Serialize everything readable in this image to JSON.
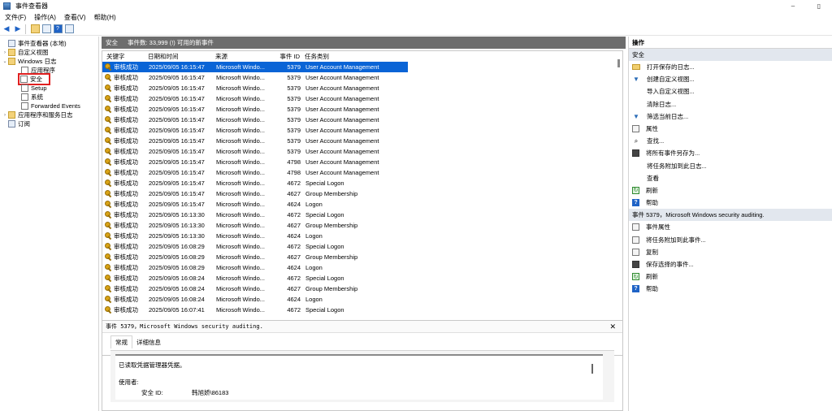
{
  "window": {
    "title": "事件查看器",
    "min": "–",
    "max": "▯"
  },
  "menu": [
    "文件(F)",
    "操作(A)",
    "查看(V)",
    "帮助(H)"
  ],
  "tree": [
    {
      "label": "事件查看器 (本地)",
      "indent": 0,
      "exp": "",
      "icon": "eventviewer-icon"
    },
    {
      "label": "自定义视图",
      "indent": 1,
      "exp": "›",
      "icon": "folder-icon"
    },
    {
      "label": "Windows 日志",
      "indent": 1,
      "exp": "⌄",
      "icon": "folder-icon"
    },
    {
      "label": "应用程序",
      "indent": 2,
      "exp": "",
      "icon": "log-icon"
    },
    {
      "label": "安全",
      "indent": 2,
      "exp": "",
      "icon": "log-icon",
      "selected": true
    },
    {
      "label": "Setup",
      "indent": 2,
      "exp": "",
      "icon": "log-icon"
    },
    {
      "label": "系统",
      "indent": 2,
      "exp": "",
      "icon": "log-icon"
    },
    {
      "label": "Forwarded Events",
      "indent": 2,
      "exp": "",
      "icon": "log-icon"
    },
    {
      "label": "应用程序和服务日志",
      "indent": 1,
      "exp": "›",
      "icon": "folder-icon"
    },
    {
      "label": "订阅",
      "indent": 1,
      "exp": "",
      "icon": "subscription-icon"
    }
  ],
  "log_header": {
    "name": "安全",
    "summary": "事件数: 33,999 (!) 可用的新事件"
  },
  "columns": {
    "keyword": "关键字",
    "datetime": "日期和时间",
    "source": "来源",
    "event_id": "事件 ID",
    "task": "任务类别"
  },
  "events": [
    {
      "kw": "审核成功",
      "dt": "2025/09/05 16:15:47",
      "src": "Microsoft Windo...",
      "id": "5379",
      "task": "User Account Management"
    },
    {
      "kw": "审核成功",
      "dt": "2025/09/05 16:15:47",
      "src": "Microsoft Windo...",
      "id": "5379",
      "task": "User Account Management"
    },
    {
      "kw": "审核成功",
      "dt": "2025/09/05 16:15:47",
      "src": "Microsoft Windo...",
      "id": "5379",
      "task": "User Account Management"
    },
    {
      "kw": "审核成功",
      "dt": "2025/09/05 16:15:47",
      "src": "Microsoft Windo...",
      "id": "5379",
      "task": "User Account Management"
    },
    {
      "kw": "审核成功",
      "dt": "2025/09/05 16:15:47",
      "src": "Microsoft Windo...",
      "id": "5379",
      "task": "User Account Management"
    },
    {
      "kw": "审核成功",
      "dt": "2025/09/05 16:15:47",
      "src": "Microsoft Windo...",
      "id": "5379",
      "task": "User Account Management"
    },
    {
      "kw": "审核成功",
      "dt": "2025/09/05 16:15:47",
      "src": "Microsoft Windo...",
      "id": "5379",
      "task": "User Account Management"
    },
    {
      "kw": "审核成功",
      "dt": "2025/09/05 16:15:47",
      "src": "Microsoft Windo...",
      "id": "5379",
      "task": "User Account Management"
    },
    {
      "kw": "审核成功",
      "dt": "2025/09/05 16:15:47",
      "src": "Microsoft Windo...",
      "id": "5379",
      "task": "User Account Management"
    },
    {
      "kw": "审核成功",
      "dt": "2025/09/05 16:15:47",
      "src": "Microsoft Windo...",
      "id": "4798",
      "task": "User Account Management"
    },
    {
      "kw": "审核成功",
      "dt": "2025/09/05 16:15:47",
      "src": "Microsoft Windo...",
      "id": "4798",
      "task": "User Account Management"
    },
    {
      "kw": "审核成功",
      "dt": "2025/09/05 16:15:47",
      "src": "Microsoft Windo...",
      "id": "4672",
      "task": "Special Logon"
    },
    {
      "kw": "审核成功",
      "dt": "2025/09/05 16:15:47",
      "src": "Microsoft Windo...",
      "id": "4627",
      "task": "Group Membership"
    },
    {
      "kw": "审核成功",
      "dt": "2025/09/05 16:15:47",
      "src": "Microsoft Windo...",
      "id": "4624",
      "task": "Logon"
    },
    {
      "kw": "审核成功",
      "dt": "2025/09/05 16:13:30",
      "src": "Microsoft Windo...",
      "id": "4672",
      "task": "Special Logon"
    },
    {
      "kw": "审核成功",
      "dt": "2025/09/05 16:13:30",
      "src": "Microsoft Windo...",
      "id": "4627",
      "task": "Group Membership"
    },
    {
      "kw": "审核成功",
      "dt": "2025/09/05 16:13:30",
      "src": "Microsoft Windo...",
      "id": "4624",
      "task": "Logon"
    },
    {
      "kw": "审核成功",
      "dt": "2025/09/05 16:08:29",
      "src": "Microsoft Windo...",
      "id": "4672",
      "task": "Special Logon"
    },
    {
      "kw": "审核成功",
      "dt": "2025/09/05 16:08:29",
      "src": "Microsoft Windo...",
      "id": "4627",
      "task": "Group Membership"
    },
    {
      "kw": "审核成功",
      "dt": "2025/09/05 16:08:29",
      "src": "Microsoft Windo...",
      "id": "4624",
      "task": "Logon"
    },
    {
      "kw": "审核成功",
      "dt": "2025/09/05 16:08:24",
      "src": "Microsoft Windo...",
      "id": "4672",
      "task": "Special Logon"
    },
    {
      "kw": "审核成功",
      "dt": "2025/09/05 16:08:24",
      "src": "Microsoft Windo...",
      "id": "4627",
      "task": "Group Membership"
    },
    {
      "kw": "审核成功",
      "dt": "2025/09/05 16:08:24",
      "src": "Microsoft Windo...",
      "id": "4624",
      "task": "Logon"
    },
    {
      "kw": "审核成功",
      "dt": "2025/09/05 16:07:41",
      "src": "Microsoft Windo...",
      "id": "4672",
      "task": "Special Logon"
    }
  ],
  "detail": {
    "title": "事件 5379，Microsoft Windows security auditing.",
    "close": "✕",
    "tabs": [
      "常规",
      "详细信息"
    ],
    "message": "已读取凭据管理器凭据。",
    "user_label": "使用者:",
    "sid_label": "安全 ID:",
    "sid_value": "韩旭娇\\86183"
  },
  "actions": {
    "title": "操作",
    "section1": "安全",
    "items1": [
      {
        "label": "打开保存的日志...",
        "icon": "open-folder-icon"
      },
      {
        "label": "创建自定义视图...",
        "icon": "filter-icon"
      },
      {
        "label": "导入自定义视图...",
        "icon": ""
      },
      {
        "label": "清除日志...",
        "icon": ""
      },
      {
        "label": "筛选当前日志...",
        "icon": "filter-icon"
      },
      {
        "label": "属性",
        "icon": "properties-icon"
      },
      {
        "label": "查找...",
        "icon": "find-icon"
      },
      {
        "label": "将所有事件另存为...",
        "icon": "save-icon"
      },
      {
        "label": "将任务附加到此日志...",
        "icon": ""
      },
      {
        "label": "查看",
        "icon": ""
      },
      {
        "label": "刷新",
        "icon": "refresh-icon"
      },
      {
        "label": "帮助",
        "icon": "help-icon"
      }
    ],
    "section2": "事件 5379，Microsoft Windows security auditing.",
    "items2": [
      {
        "label": "事件属性",
        "icon": "properties-icon"
      },
      {
        "label": "将任务附加到此事件...",
        "icon": "task-icon"
      },
      {
        "label": "复制",
        "icon": "copy-icon"
      },
      {
        "label": "保存选择的事件...",
        "icon": "save-icon"
      },
      {
        "label": "刷新",
        "icon": "refresh-icon"
      },
      {
        "label": "帮助",
        "icon": "help-icon"
      }
    ]
  }
}
